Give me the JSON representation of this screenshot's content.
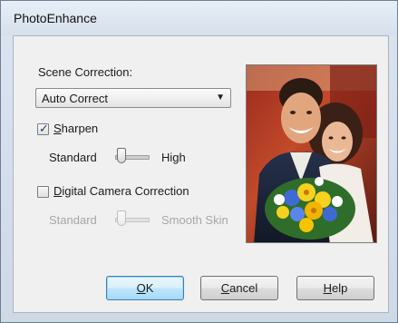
{
  "window": {
    "title": "PhotoEnhance"
  },
  "scene_correction": {
    "label": "Scene Correction:",
    "selected": "Auto Correct"
  },
  "sharpen": {
    "label_prefix": "S",
    "label_rest": "harpen",
    "checked": true,
    "slider_min_label": "Standard",
    "slider_max_label": "High"
  },
  "digital_camera": {
    "label_prefix": "D",
    "label_rest": "igital Camera Correction",
    "checked": false,
    "slider_min_label": "Standard",
    "slider_max_label": "Smooth Skin"
  },
  "buttons": {
    "ok_u": "O",
    "ok_rest": "K",
    "cancel_u": "C",
    "cancel_rest": "ancel",
    "help_u": "H",
    "help_rest": "elp"
  }
}
